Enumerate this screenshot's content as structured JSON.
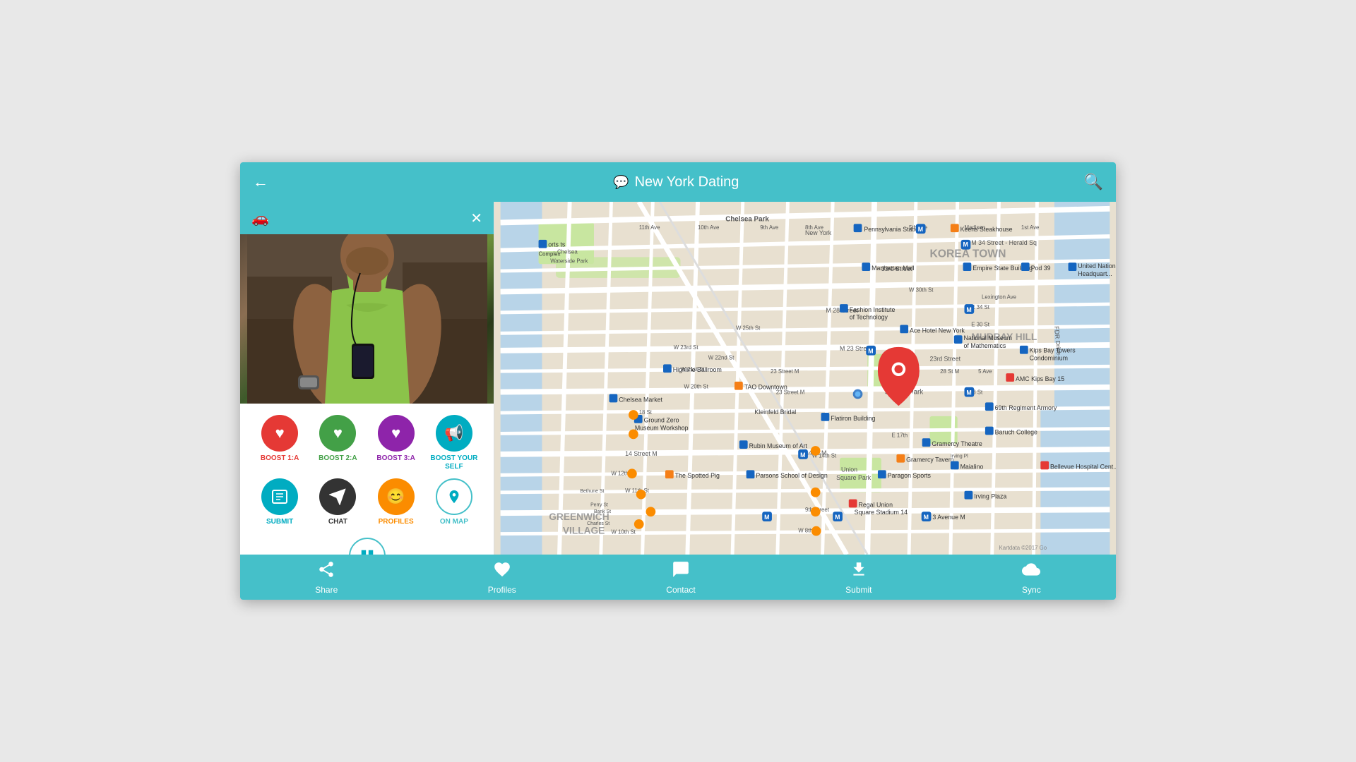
{
  "header": {
    "title": "New York Dating",
    "back_label": "←",
    "search_label": "🔍",
    "chat_icon": "💬"
  },
  "subheader": {
    "car_icon": "🚗",
    "close_icon": "✕"
  },
  "action_buttons": [
    {
      "id": "boost1",
      "label": "BOOST 1:A",
      "icon": "♥",
      "bg_class": "btn-red",
      "label_class": "label-red"
    },
    {
      "id": "boost2",
      "label": "BOOST 2:A",
      "icon": "♥",
      "bg_class": "btn-green",
      "label_class": "label-green"
    },
    {
      "id": "boost3",
      "label": "BOOST 3:A",
      "icon": "♥",
      "bg_class": "btn-purple",
      "label_class": "label-purple"
    },
    {
      "id": "boost-self",
      "label": "BOOST YOUR SELF",
      "icon": "📢",
      "bg_class": "btn-cyan",
      "label_class": "label-cyan"
    },
    {
      "id": "submit",
      "label": "SUBMIT",
      "icon": "📋",
      "bg_class": "btn-cyan",
      "label_class": "label-cyan"
    },
    {
      "id": "chat",
      "label": "CHAT",
      "icon": "✈",
      "bg_class": "btn-dark",
      "label_class": "label-dark"
    },
    {
      "id": "profiles",
      "label": "PROFILES",
      "icon": "😊",
      "bg_class": "btn-orange",
      "label_class": "label-orange"
    },
    {
      "id": "on-map",
      "label": "ON MAP",
      "icon": "📍",
      "bg_class": "btn-teal-outline",
      "label_class": "label-teal"
    }
  ],
  "grid_btn": {
    "icon": "⊞",
    "label": ""
  },
  "bottom_tabs": [
    {
      "id": "share",
      "icon": "↗",
      "label": "Share"
    },
    {
      "id": "profiles",
      "icon": "♡",
      "label": "Profiles"
    },
    {
      "id": "contact",
      "icon": "💬",
      "label": "Contact"
    },
    {
      "id": "submit",
      "icon": "📤",
      "label": "Submit"
    },
    {
      "id": "sync",
      "icon": "☁",
      "label": "Sync"
    }
  ],
  "map": {
    "watermark": "Kartdata ©2017 Go"
  }
}
